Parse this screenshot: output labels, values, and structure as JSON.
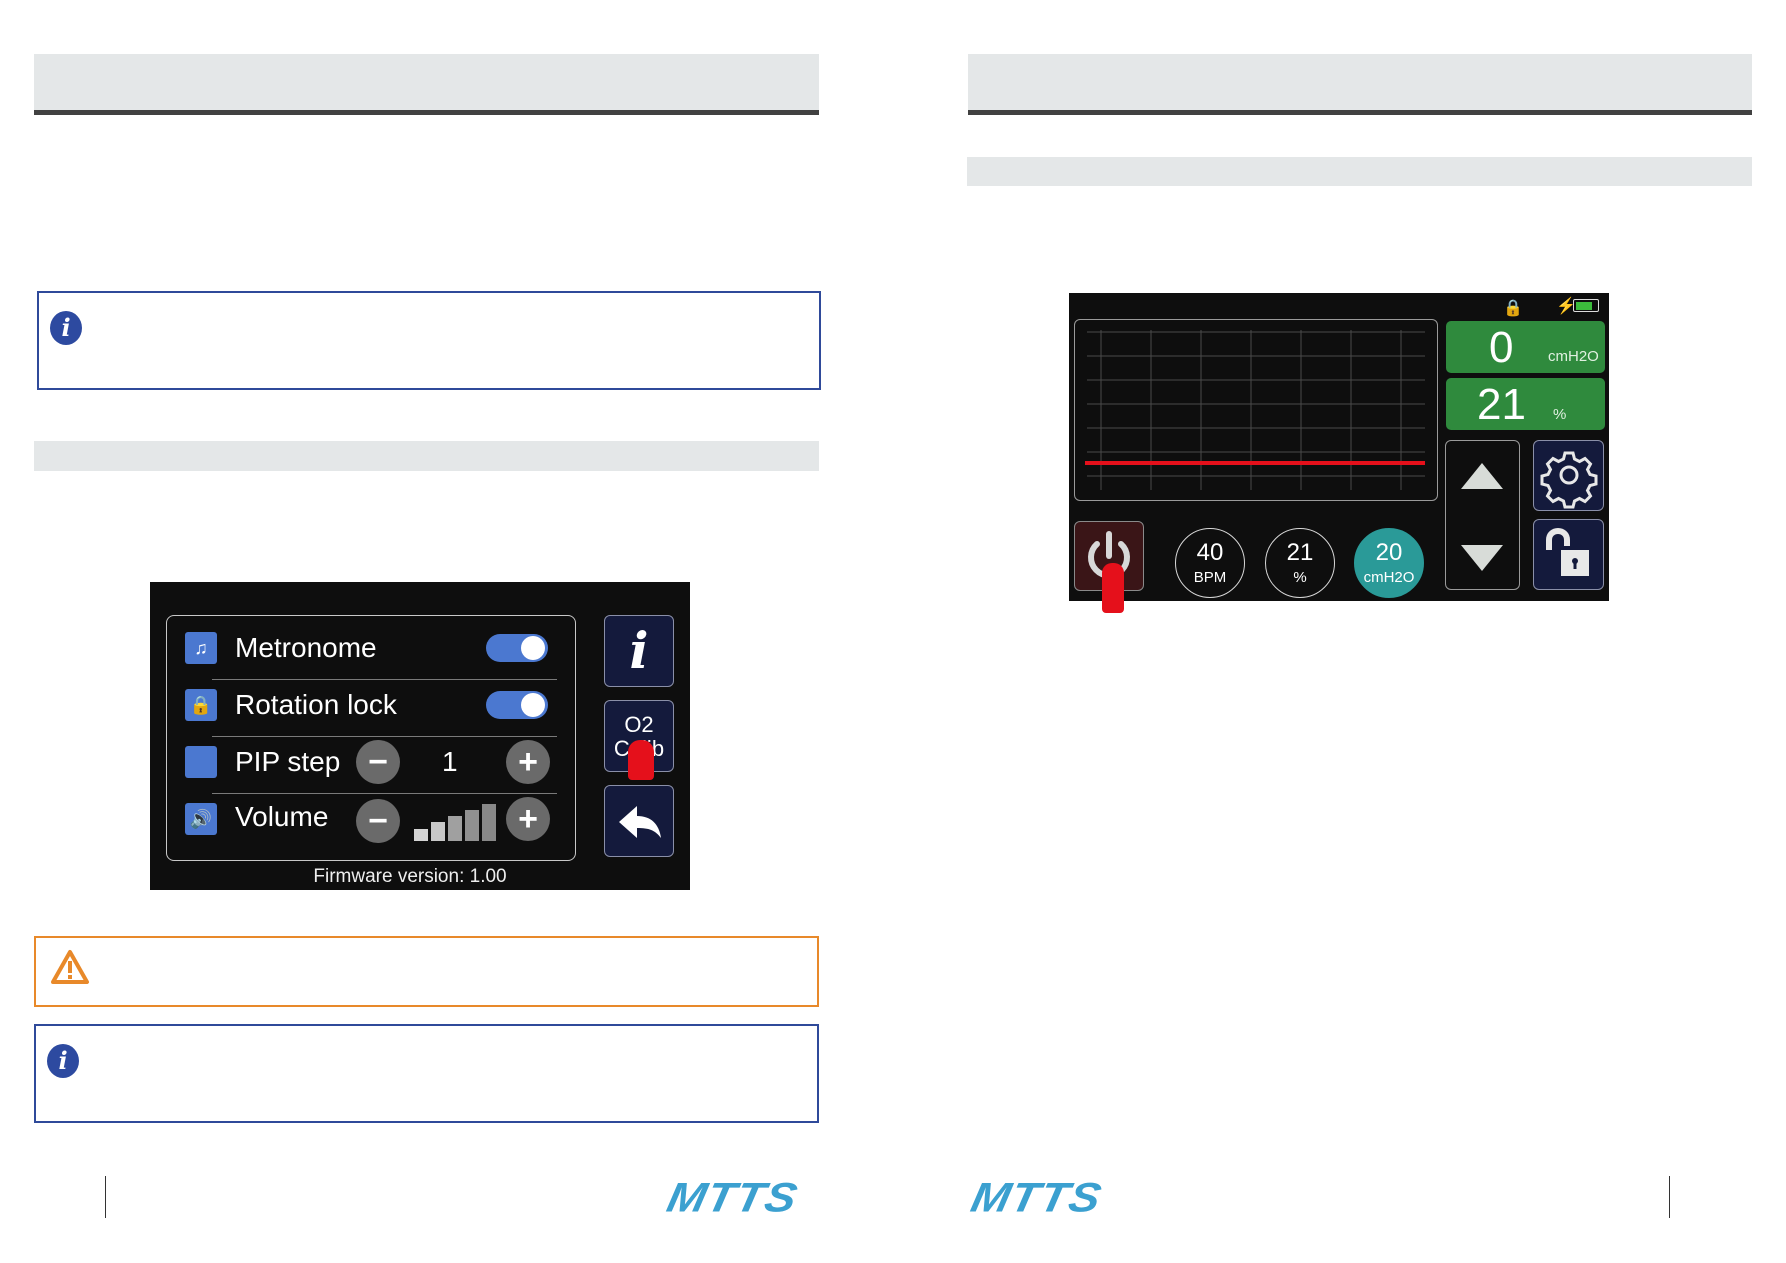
{
  "left_page": {
    "header_band": "",
    "section_band": "",
    "settings_screen": {
      "rows": [
        {
          "label": "Metronome",
          "icon": "metronome-icon",
          "control": "toggle",
          "state": "on"
        },
        {
          "label": "Rotation lock",
          "icon": "rotation-lock-icon",
          "control": "toggle",
          "state": "on"
        },
        {
          "label": "PIP step",
          "icon": "blank-square",
          "control": "stepper",
          "value": "1",
          "minus": "−",
          "plus": "+"
        },
        {
          "label": "Volume",
          "icon": "speaker-icon",
          "control": "stepper",
          "volume_level": "5 of 5 bars",
          "minus": "−",
          "plus": "+"
        }
      ],
      "side_buttons": {
        "info": "i",
        "o2_calib_line1": "O2",
        "o2_calib_line2": "Calib",
        "back": "back-arrow-icon"
      },
      "firmware": "Firmware version: 1.00"
    }
  },
  "right_page": {
    "header_band": "",
    "section_band": "",
    "main_screen": {
      "status_icons": [
        "rotation-lock-icon",
        "charging-icon",
        "battery-icon"
      ],
      "pressure_value": "0",
      "pressure_unit": "cmH2O",
      "oxygen_value": "21",
      "oxygen_unit": "%",
      "settings": [
        {
          "value": "40",
          "unit": "BPM",
          "active": false
        },
        {
          "value": "21",
          "unit": "%",
          "active": false
        },
        {
          "value": "20",
          "unit": "cmH2O",
          "active": true
        }
      ],
      "buttons": [
        "power-icon",
        "up-arrow-icon",
        "down-arrow-icon",
        "gear-icon",
        "unlock-icon"
      ]
    }
  },
  "footer": {
    "logo_left": "MTTS",
    "logo_right": "MTTS"
  },
  "colors": {
    "band": "#e4e7e8",
    "info_border": "#2f4a9a",
    "warning_border": "#e8892a",
    "screen_green": "#2f8a3d",
    "screen_teal": "#2a9a98",
    "toggle_blue": "#4b78d0",
    "logo_blue": "#3ba0d0",
    "waveform_red": "#e5101b"
  }
}
